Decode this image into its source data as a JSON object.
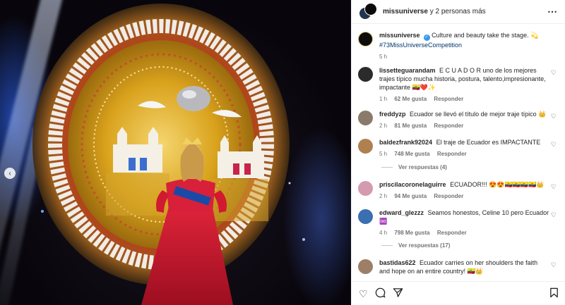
{
  "header": {
    "account": "missuniverse",
    "others": "y 2 personas más",
    "more_icon": "⋯"
  },
  "caption": {
    "username": "missuniverse",
    "text": "Culture and beauty take the stage. 💫",
    "hashtag": "#73MissUniverseCompetition",
    "time": "5 h"
  },
  "comments": [
    {
      "username": "lissetteguarandam",
      "text": "E C U A D O R uno de los mejores trajes típico mucha historia, postura, talento,impresionante, impactante 🇪🇨❤️✨",
      "time": "1 h",
      "likes": "62 Me gusta",
      "reply": "Responder",
      "color": "#2b2b2b"
    },
    {
      "username": "freddyzp",
      "text": "Ecuador se llevó el título de mejor traje típico 👑",
      "time": "2 h",
      "likes": "81 Me gusta",
      "reply": "Responder",
      "color": "#8a7a6a"
    },
    {
      "username": "baldezfrank92024",
      "text": "El traje de Ecuador es IMPACTANTE",
      "time": "5 h",
      "likes": "748 Me gusta",
      "reply": "Responder",
      "color": "#b08050"
    },
    {
      "username": "priscilacoronelaguirre",
      "text": "ECUADOR!!! 😍😍🇪🇨🇪🇨🇪🇨🇪🇨👑",
      "time": "2 h",
      "likes": "94 Me gusta",
      "reply": "Responder",
      "color": "#d49ab0"
    },
    {
      "username": "edward_glezzz",
      "text": "Seamos honestos, Celine 10 pero Ecuador ♾️",
      "time": "4 h",
      "likes": "798 Me gusta",
      "reply": "Responder",
      "color": "#3a6fb0"
    },
    {
      "username": "bastidas622",
      "text": "Ecuador carries on her shoulders the faith and hope on an entire country! 🇪🇨👑",
      "time": "",
      "likes": "",
      "reply": "",
      "color": "#9c7f66"
    }
  ],
  "view_replies": [
    "Ver respuestas (4)",
    "Ver respuestas (17)"
  ],
  "action_icons": {
    "like": "heart-icon",
    "comment": "comment-icon",
    "share": "share-icon",
    "save": "bookmark-icon"
  },
  "colors": {
    "link": "#00376b",
    "secondary_text": "#737373",
    "verified": "#3897f0",
    "gown_red": "#c8102e",
    "gold": "#d4a017"
  }
}
